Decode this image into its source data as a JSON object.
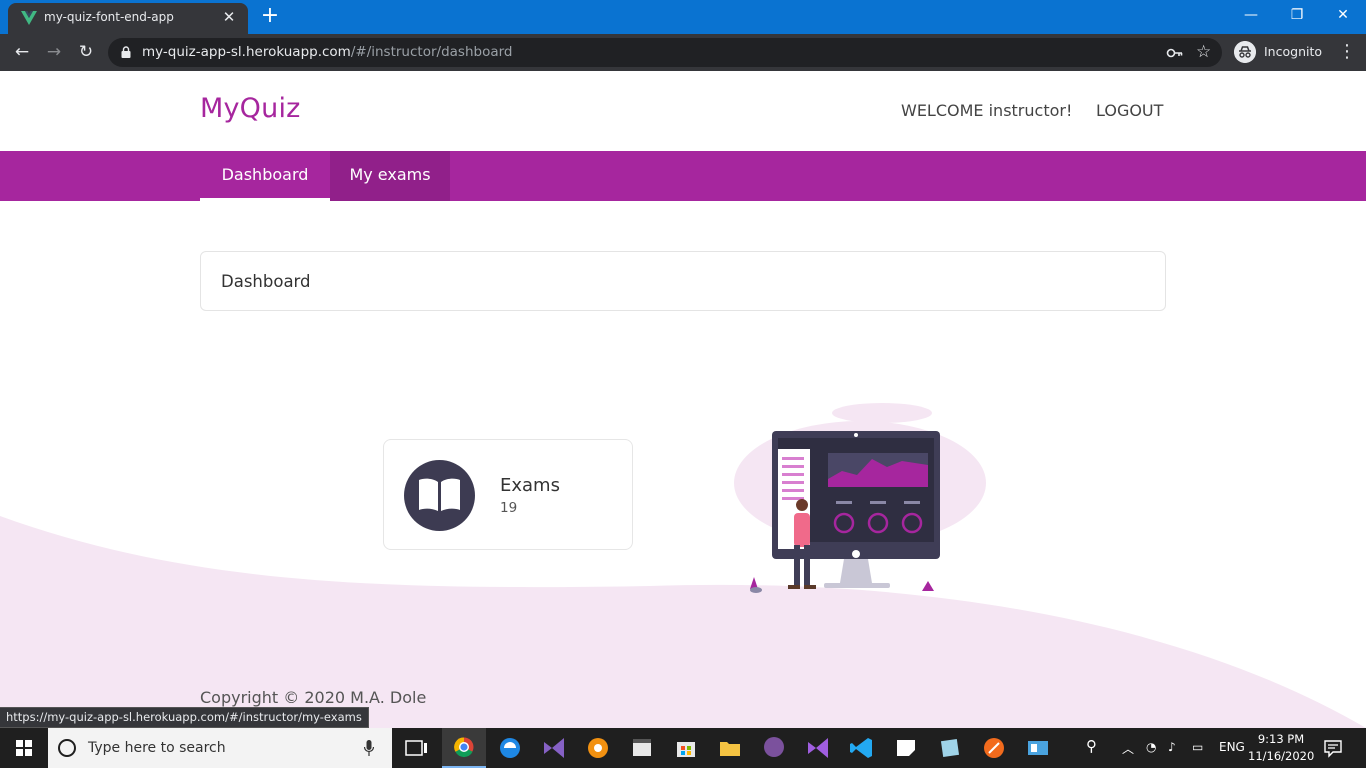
{
  "browser": {
    "tab_title": "my-quiz-font-end-app",
    "url_host": "my-quiz-app-sl.herokuapp.com",
    "url_path": "/#/instructor/dashboard",
    "profile_label": "Incognito",
    "status_url": "https://my-quiz-app-sl.herokuapp.com/#/instructor/my-exams"
  },
  "header": {
    "brand": "MyQuiz",
    "welcome": "WELCOME instructor!",
    "logout": "LOGOUT"
  },
  "nav": {
    "tabs": [
      {
        "label": "Dashboard",
        "active": true
      },
      {
        "label": "My exams",
        "active": false
      }
    ]
  },
  "main": {
    "card_title": "Dashboard",
    "stats": [
      {
        "label": "Exams",
        "count": "19",
        "icon": "book-icon"
      }
    ]
  },
  "footer": {
    "copyright": "Copyright © 2020 M.A. Dole"
  },
  "taskbar": {
    "search_placeholder": "Type here to search",
    "language": "ENG",
    "time": "9:13 PM",
    "date": "11/16/2020"
  },
  "colors": {
    "brand": "#a6269e",
    "nav_bg": "#a6269e",
    "wave": "#f5e6f3",
    "icon_dark": "#3d3b52"
  }
}
